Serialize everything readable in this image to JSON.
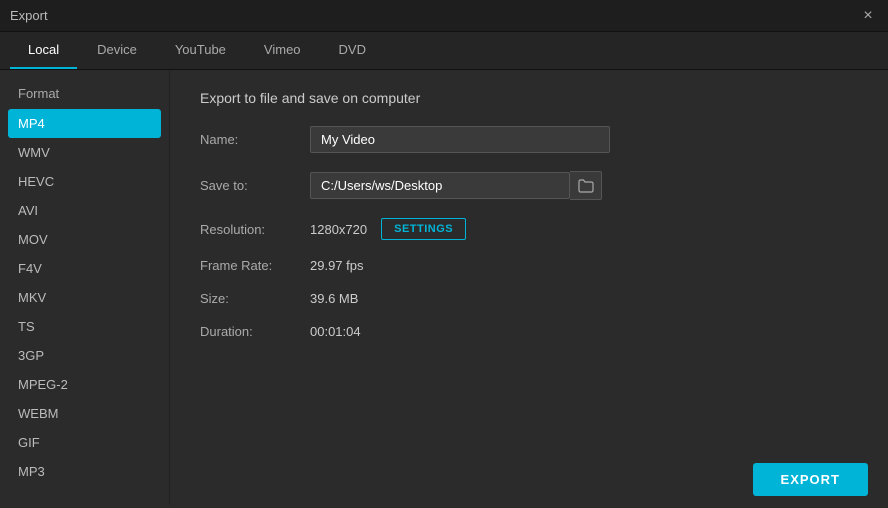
{
  "titleBar": {
    "title": "Export",
    "closeLabel": "×"
  },
  "tabs": [
    {
      "id": "local",
      "label": "Local",
      "active": true
    },
    {
      "id": "device",
      "label": "Device",
      "active": false
    },
    {
      "id": "youtube",
      "label": "YouTube",
      "active": false
    },
    {
      "id": "vimeo",
      "label": "Vimeo",
      "active": false
    },
    {
      "id": "dvd",
      "label": "DVD",
      "active": false
    }
  ],
  "sidebar": {
    "title": "Format",
    "items": [
      {
        "id": "mp4",
        "label": "MP4",
        "active": true
      },
      {
        "id": "wmv",
        "label": "WMV",
        "active": false
      },
      {
        "id": "hevc",
        "label": "HEVC",
        "active": false
      },
      {
        "id": "avi",
        "label": "AVI",
        "active": false
      },
      {
        "id": "mov",
        "label": "MOV",
        "active": false
      },
      {
        "id": "f4v",
        "label": "F4V",
        "active": false
      },
      {
        "id": "mkv",
        "label": "MKV",
        "active": false
      },
      {
        "id": "ts",
        "label": "TS",
        "active": false
      },
      {
        "id": "3gp",
        "label": "3GP",
        "active": false
      },
      {
        "id": "mpeg2",
        "label": "MPEG-2",
        "active": false
      },
      {
        "id": "webm",
        "label": "WEBM",
        "active": false
      },
      {
        "id": "gif",
        "label": "GIF",
        "active": false
      },
      {
        "id": "mp3",
        "label": "MP3",
        "active": false
      }
    ]
  },
  "panel": {
    "title": "Export to file and save on computer",
    "fields": {
      "nameLabel": "Name:",
      "nameValue": "My Video",
      "saveToLabel": "Save to:",
      "saveToValue": "C:/Users/ws/Desktop",
      "resolutionLabel": "Resolution:",
      "resolutionValue": "1280x720",
      "settingsLabel": "SETTINGS",
      "frameRateLabel": "Frame Rate:",
      "frameRateValue": "29.97 fps",
      "sizeLabel": "Size:",
      "sizeValue": "39.6 MB",
      "durationLabel": "Duration:",
      "durationValue": "00:01:04"
    }
  },
  "exportButton": "EXPORT",
  "icons": {
    "folder": "🗀",
    "close": "×"
  }
}
